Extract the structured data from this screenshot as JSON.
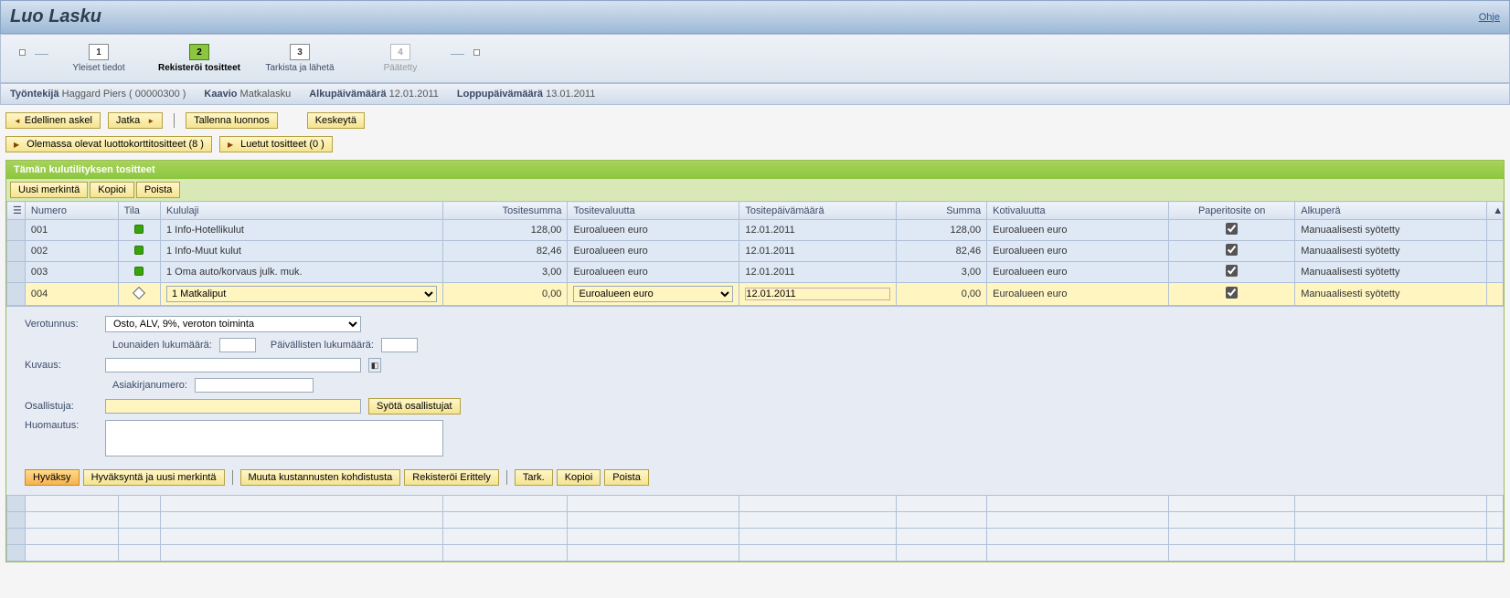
{
  "header": {
    "title": "Luo Lasku",
    "help": "Ohje"
  },
  "steps": [
    {
      "num": "1",
      "label": "Yleiset tiedot",
      "active": false,
      "disabled": false
    },
    {
      "num": "2",
      "label": "Rekisteröi tositteet",
      "active": true,
      "disabled": false
    },
    {
      "num": "3",
      "label": "Tarkista ja lähetä",
      "active": false,
      "disabled": false
    },
    {
      "num": "4",
      "label": "Päätetty",
      "active": false,
      "disabled": true
    }
  ],
  "info": {
    "employee_label": "Työntekijä",
    "employee_value": "Haggard Piers ( 00000300 )",
    "schema_label": "Kaavio",
    "schema_value": "Matkalasku",
    "startdate_label": "Alkupäivämäärä",
    "startdate_value": "12.01.2011",
    "enddate_label": "Loppupäivämäärä",
    "enddate_value": "13.01.2011"
  },
  "toolbar": {
    "prev": "Edellinen askel",
    "next": "Jatka",
    "save_draft": "Tallenna luonnos",
    "cancel": "Keskeytä",
    "existing_cc": "Olemassa olevat luottokorttitositteet (8 )",
    "read_receipts": "Luetut tositteet (0 )"
  },
  "panel": {
    "title": "Tämän kulutilityksen tositteet",
    "btn_new": "Uusi merkintä",
    "btn_copy": "Kopioi",
    "btn_delete": "Poista"
  },
  "columns": {
    "numero": "Numero",
    "tila": "Tila",
    "kululaji": "Kululaji",
    "tositesumma": "Tositesumma",
    "tositevaluutta": "Tositevaluutta",
    "tositepvm": "Tositepäivämäärä",
    "summa": "Summa",
    "kotivaluutta": "Kotivaluutta",
    "paperi": "Paperitosite on",
    "alkupera": "Alkuperä"
  },
  "rows": [
    {
      "numero": "001",
      "status": "green",
      "kululaji": "1 Info-Hotellikulut",
      "tositesumma": "128,00",
      "tositevaluutta": "Euroalueen euro",
      "tositepvm": "12.01.2011",
      "summa": "128,00",
      "kotivaluutta": "Euroalueen euro",
      "paperi": true,
      "alkupera": "Manuaalisesti syötetty",
      "editable": false
    },
    {
      "numero": "002",
      "status": "green",
      "kululaji": "1 Info-Muut kulut",
      "tositesumma": "82,46",
      "tositevaluutta": "Euroalueen euro",
      "tositepvm": "12.01.2011",
      "summa": "82,46",
      "kotivaluutta": "Euroalueen euro",
      "paperi": true,
      "alkupera": "Manuaalisesti syötetty",
      "editable": false
    },
    {
      "numero": "003",
      "status": "green",
      "kululaji": "1 Oma auto/korvaus julk. muk.",
      "tositesumma": "3,00",
      "tositevaluutta": "Euroalueen euro",
      "tositepvm": "12.01.2011",
      "summa": "3,00",
      "kotivaluutta": "Euroalueen euro",
      "paperi": true,
      "alkupera": "Manuaalisesti syötetty",
      "editable": false
    },
    {
      "numero": "004",
      "status": "diamond",
      "kululaji": "1 Matkaliput",
      "tositesumma": "0,00",
      "tositevaluutta": "Euroalueen euro",
      "tositepvm": "12.01.2011",
      "summa": "0,00",
      "kotivaluutta": "Euroalueen euro",
      "paperi": true,
      "alkupera": "Manuaalisesti syötetty",
      "editable": true
    }
  ],
  "detail": {
    "tax_label": "Verotunnus:",
    "tax_value": "Osto, ALV, 9%, veroton toiminta",
    "lunch_label": "Lounaiden lukumäärä:",
    "dinner_label": "Päivällisten lukumäärä:",
    "desc_label": "Kuvaus:",
    "docno_label": "Asiakirjanumero:",
    "participant_label": "Osallistuja:",
    "enter_participants": "Syötä osallistujat",
    "note_label": "Huomautus:",
    "btn_approve": "Hyväksy",
    "btn_approve_new": "Hyväksyntä ja uusi merkintä",
    "btn_change_cost": "Muuta kustannusten kohdistusta",
    "btn_register": "Rekisteröi Erittely",
    "btn_check": "Tark.",
    "btn_copy": "Kopioi",
    "btn_delete": "Poista"
  }
}
